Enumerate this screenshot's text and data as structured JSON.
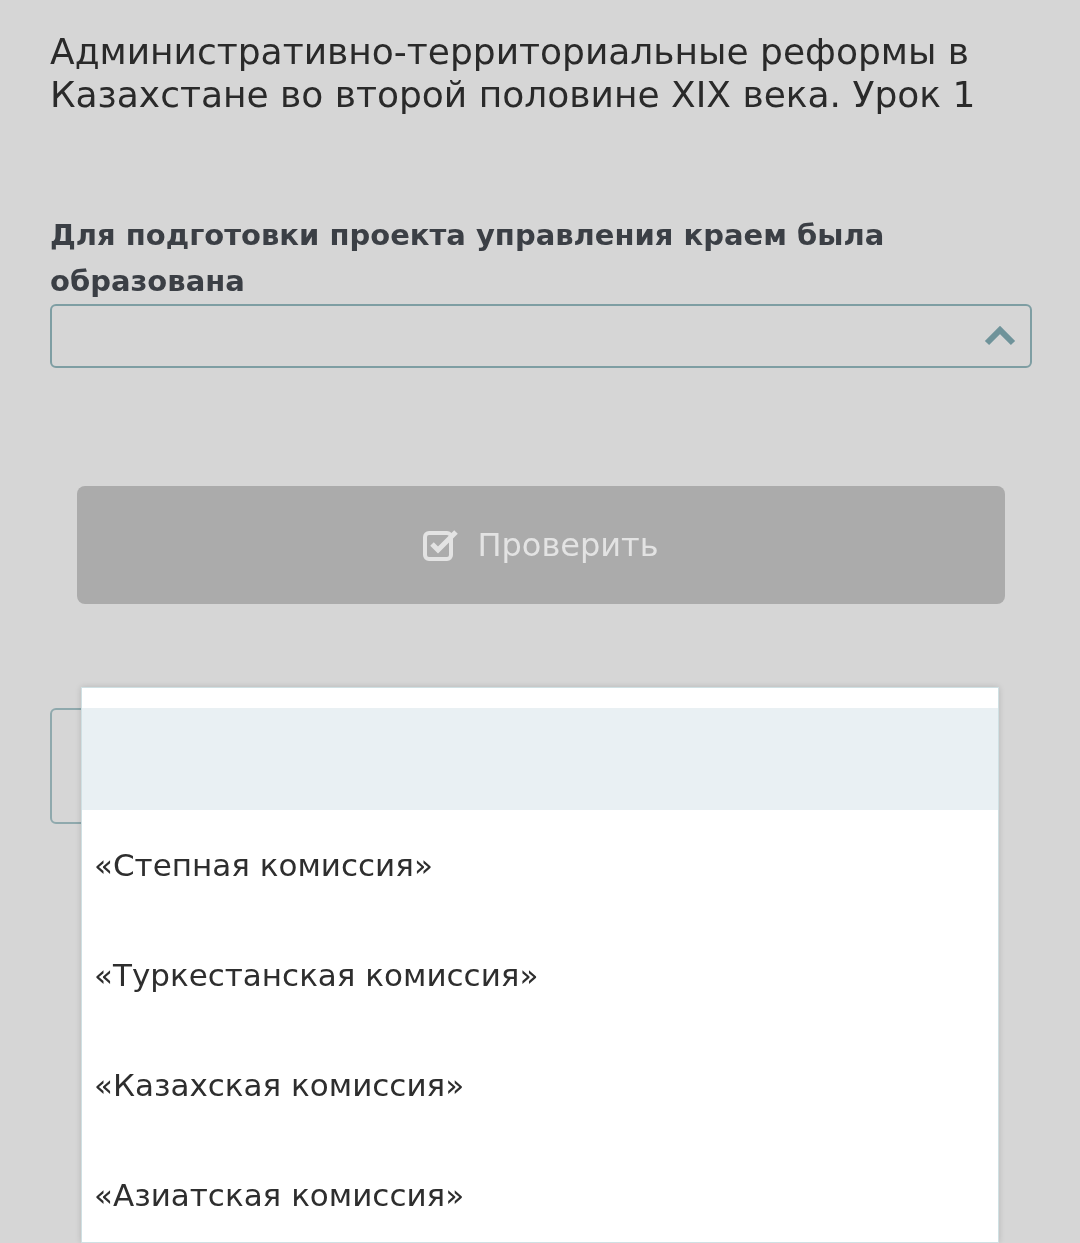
{
  "title": "Административно-территориальные реформы в Казахстане во второй половине XIX века. Урок 1",
  "question": "Для подготовки проекта управления краем была образована",
  "select": {
    "expanded": true
  },
  "check_button": {
    "label": "Проверить",
    "disabled": true
  },
  "options": [
    {
      "selected": true
    },
    {
      "label": "«Степная комиссия»",
      "selected": false
    },
    {
      "label": "«Туркестанская комиссия»",
      "selected": false
    },
    {
      "label": "«Казахская комиссия»",
      "selected": false
    },
    {
      "label": "«Азиатская комиссия»",
      "selected": false
    }
  ]
}
